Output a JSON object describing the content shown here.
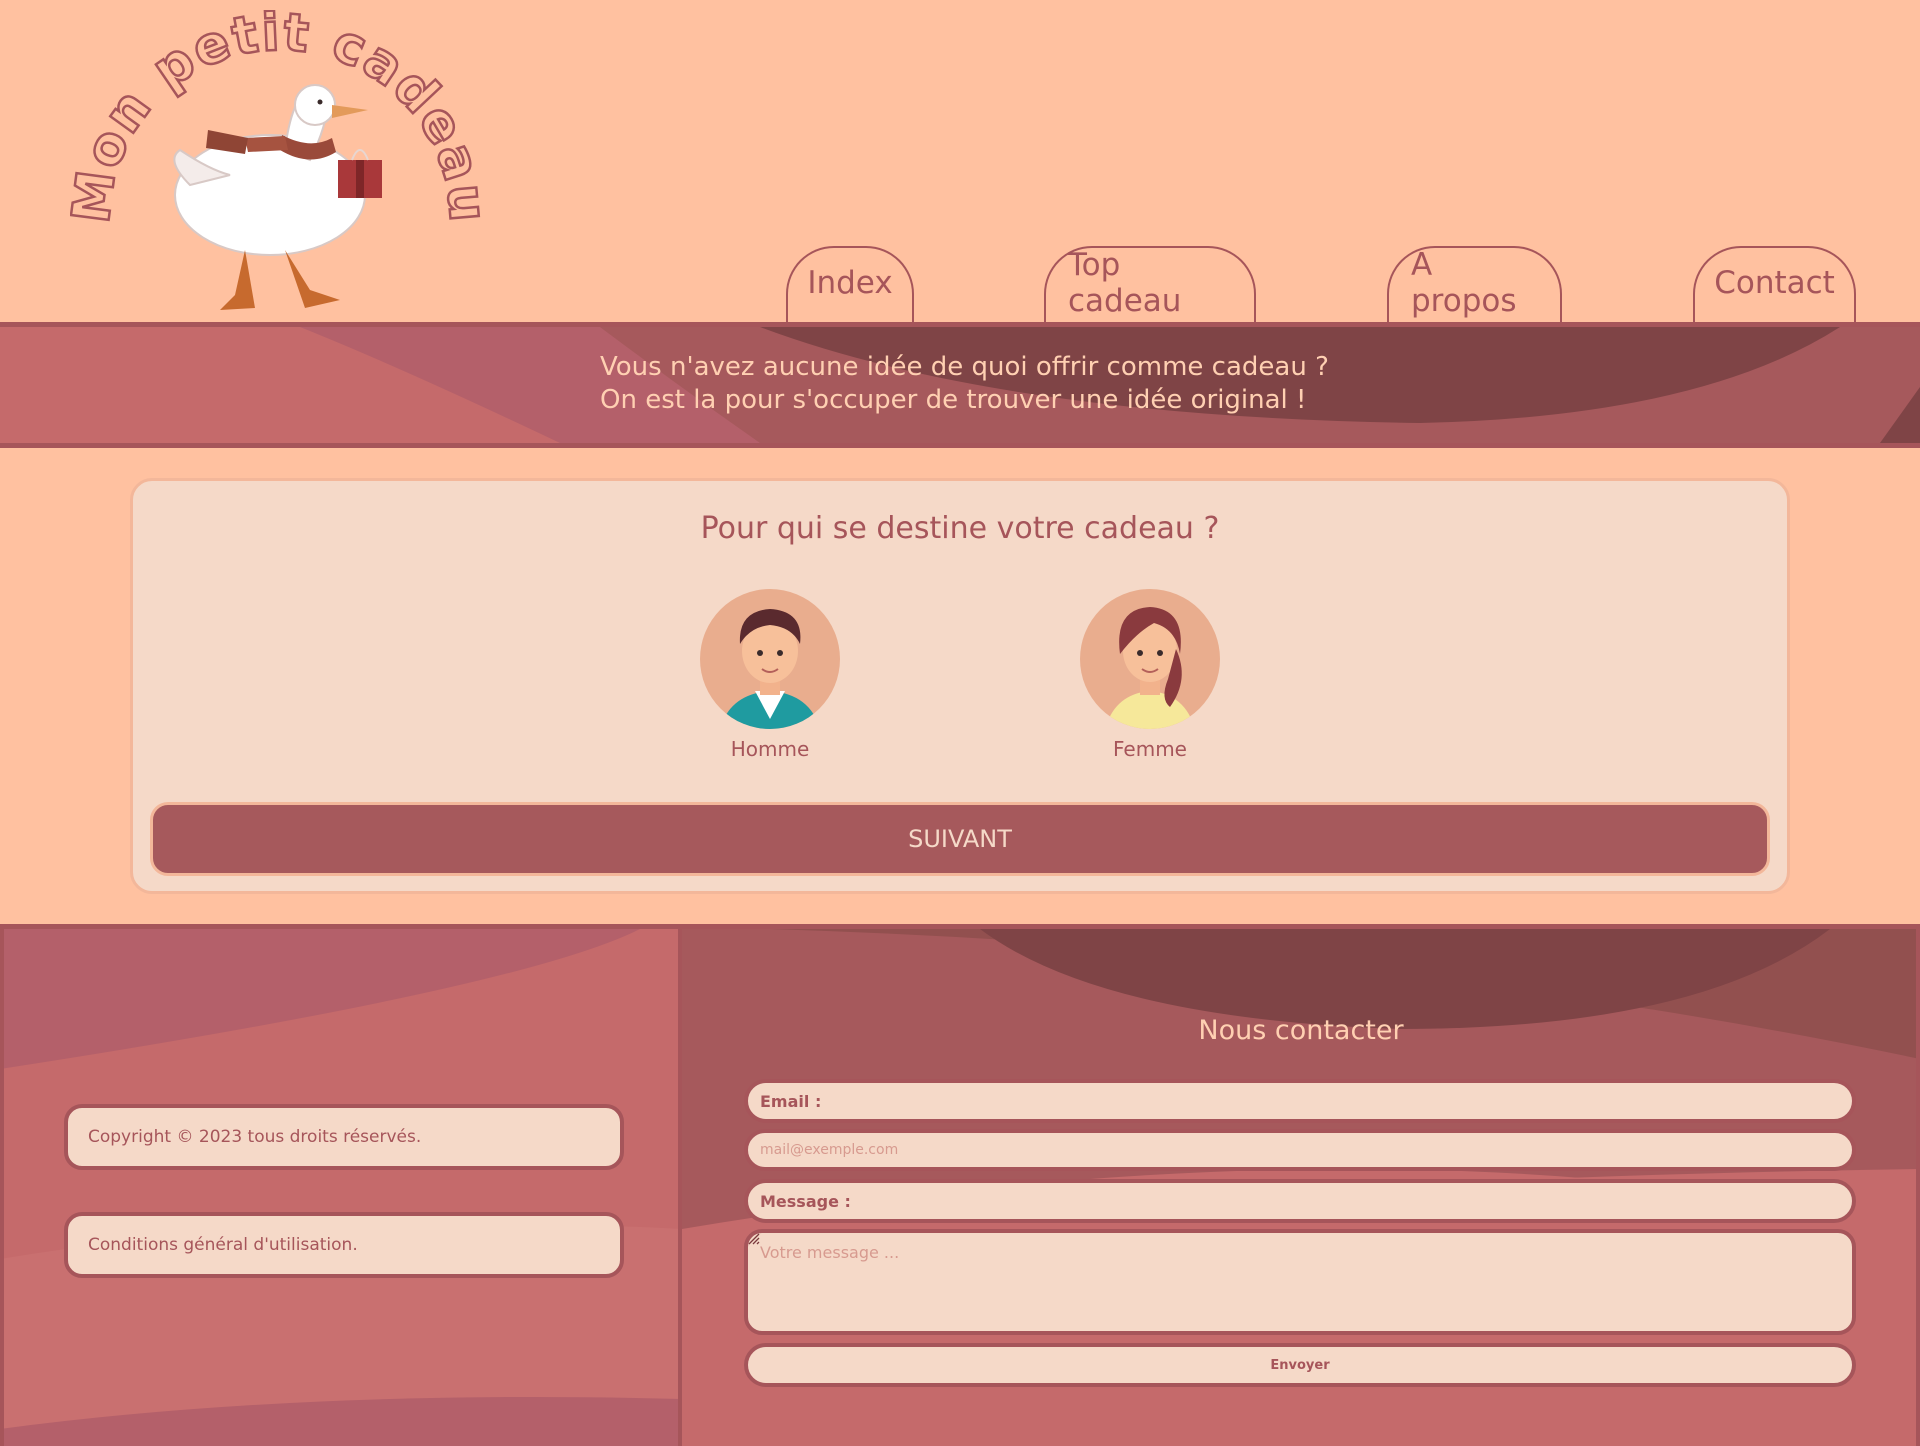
{
  "header": {
    "logo_text": "Mon petit cadeau",
    "nav": {
      "index": "Index",
      "top": "Top cadeau",
      "apropos": "A propos",
      "contact": "Contact"
    }
  },
  "banner": {
    "line1": "Vous n'avez aucune idée de quoi offrir comme cadeau ?",
    "line2": "On est la pour s'occuper de trouver une idée original !"
  },
  "main": {
    "question": "Pour qui se destine votre cadeau ?",
    "choices": [
      {
        "label": "Homme",
        "icon": "man-avatar-icon"
      },
      {
        "label": "Femme",
        "icon": "woman-avatar-icon"
      }
    ],
    "next_label": "SUIVANT"
  },
  "footer": {
    "copyright": "Copyright © 2023 tous droits réservés.",
    "cgu": "Conditions général d'utilisation.",
    "contact_title": "Nous contacter",
    "email_label": "Email :",
    "email_placeholder": "mail@exemple.com",
    "message_label": "Message :",
    "message_placeholder": "Votre message ...",
    "send_label": "Envoyer"
  },
  "colors": {
    "background": "#ffc1a0",
    "accent": "#a6555a",
    "card": "#f5d9c8",
    "banner_text": "#ffd0b2"
  }
}
